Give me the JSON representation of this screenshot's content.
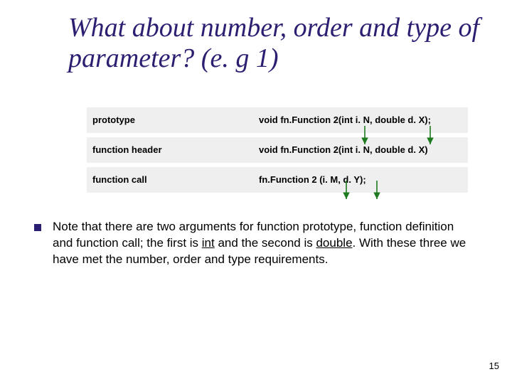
{
  "title": "What about number, order and type of parameter? (e. g 1)",
  "rows": [
    {
      "label": "prototype",
      "code": "void fn.Function 2(int i. N, double d. X);"
    },
    {
      "label": "function header",
      "code": "void fn.Function 2(int i. N, double d. X)"
    },
    {
      "label": "function call",
      "code": "fn.Function 2 (i. M, d. Y);"
    }
  ],
  "note_parts": {
    "a": "Note that there are two arguments for function prototype, function definition and function call; the first is ",
    "int": "int",
    "b": " and the second is ",
    "double": "double",
    "c": ". With these three we have met the number, order and type requirements."
  },
  "page_number": "15",
  "arrow_color": "#1e7a1e"
}
